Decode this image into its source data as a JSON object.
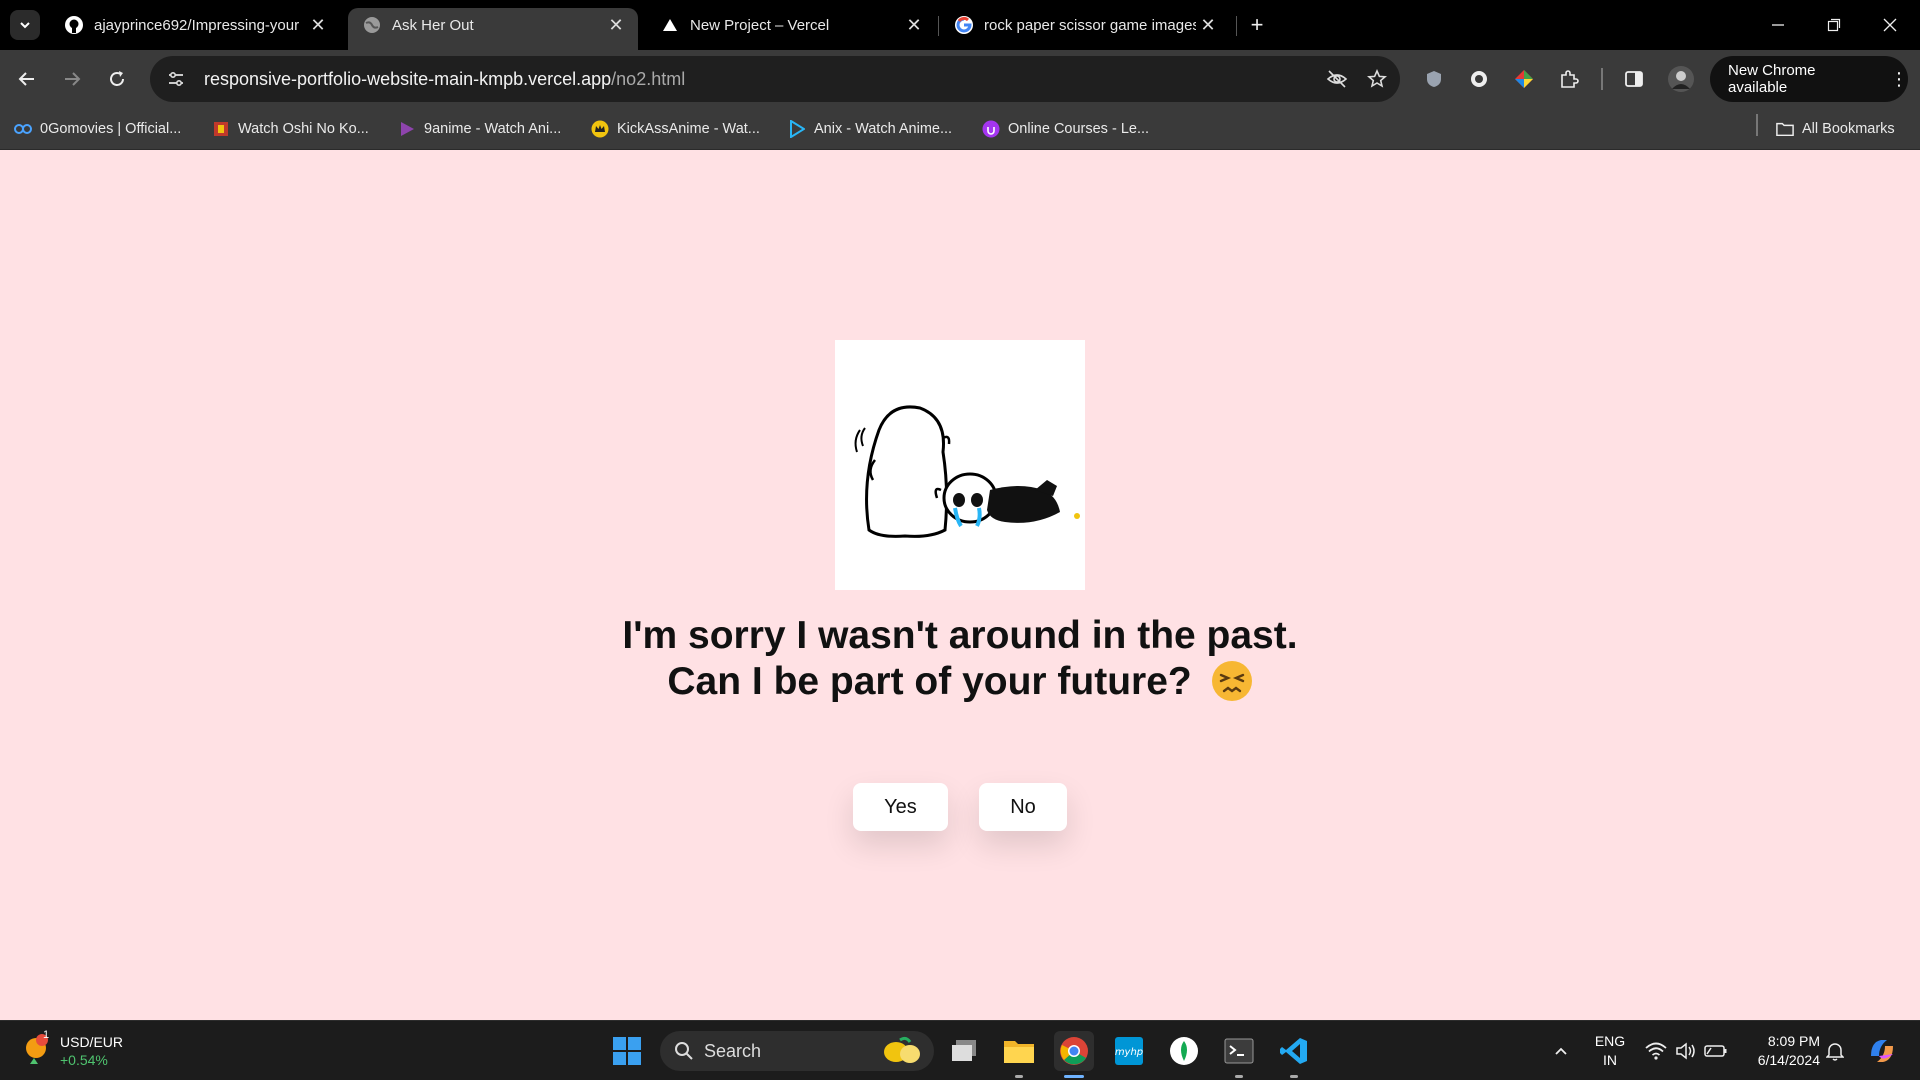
{
  "browser": {
    "tabs": [
      {
        "title": "ajayprince692/Impressing-your",
        "icon": "github-icon"
      },
      {
        "title": "Ask Her Out",
        "icon": "globe-icon",
        "active": true
      },
      {
        "title": "New Project – Vercel",
        "icon": "vercel-icon"
      },
      {
        "title": "rock paper scissor game images",
        "icon": "google-icon"
      }
    ],
    "url_host": "responsive-portfolio-website-main-kmpb.vercel.app",
    "url_path": "/no2.html",
    "update_label": "New Chrome available",
    "bookmarks": [
      "0Gomovies | Official...",
      "Watch Oshi No Ko...",
      "9anime - Watch Ani...",
      "KickAssAnime - Wat...",
      "Anix - Watch Anime...",
      "Online Courses - Le..."
    ],
    "all_bookmarks": "All Bookmarks"
  },
  "page": {
    "question": "I'm sorry I wasn't around in the past. Can I be part of your future?",
    "yes_label": "Yes",
    "no_label": "No",
    "background": "#ffe1e4"
  },
  "taskbar": {
    "widget_title": "USD/EUR",
    "widget_change": "+0.54%",
    "widget_badge": "1",
    "search_placeholder": "Search",
    "lang_line1": "ENG",
    "lang_line2": "IN",
    "time": "8:09 PM",
    "date": "6/14/2024"
  }
}
